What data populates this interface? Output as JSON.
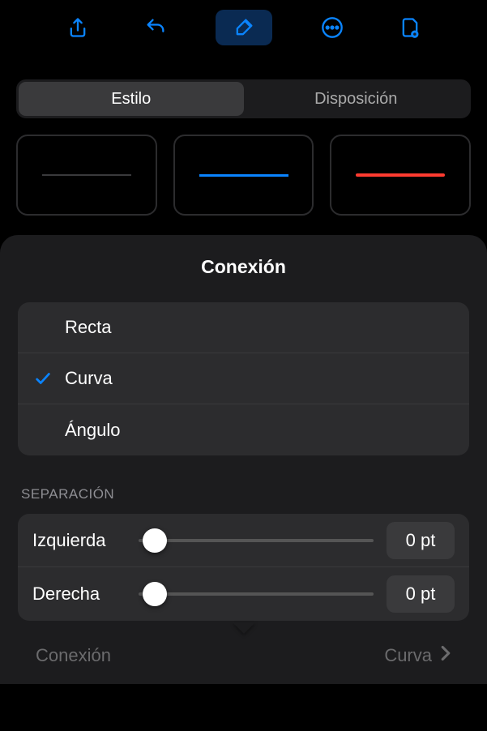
{
  "toolbar": {
    "icons": [
      "share-icon",
      "undo-icon",
      "brush-icon",
      "more-icon",
      "document-icon"
    ],
    "active_index": 2
  },
  "segmented": {
    "tabs": [
      "Estilo",
      "Disposición"
    ],
    "active_index": 0
  },
  "styles": {
    "colors": [
      "#3a3a3c",
      "#0a84ff",
      "#ff3b30"
    ]
  },
  "sheet": {
    "title": "Conexión",
    "options": [
      {
        "label": "Recta",
        "selected": false
      },
      {
        "label": "Curva",
        "selected": true
      },
      {
        "label": "Ángulo",
        "selected": false
      }
    ],
    "separation": {
      "header": "SEPARACIÓN",
      "rows": [
        {
          "label": "Izquierda",
          "value": "0 pt",
          "position": 0
        },
        {
          "label": "Derecha",
          "value": "0 pt",
          "position": 0
        }
      ]
    }
  },
  "bottom": {
    "label": "Conexión",
    "value": "Curva"
  }
}
